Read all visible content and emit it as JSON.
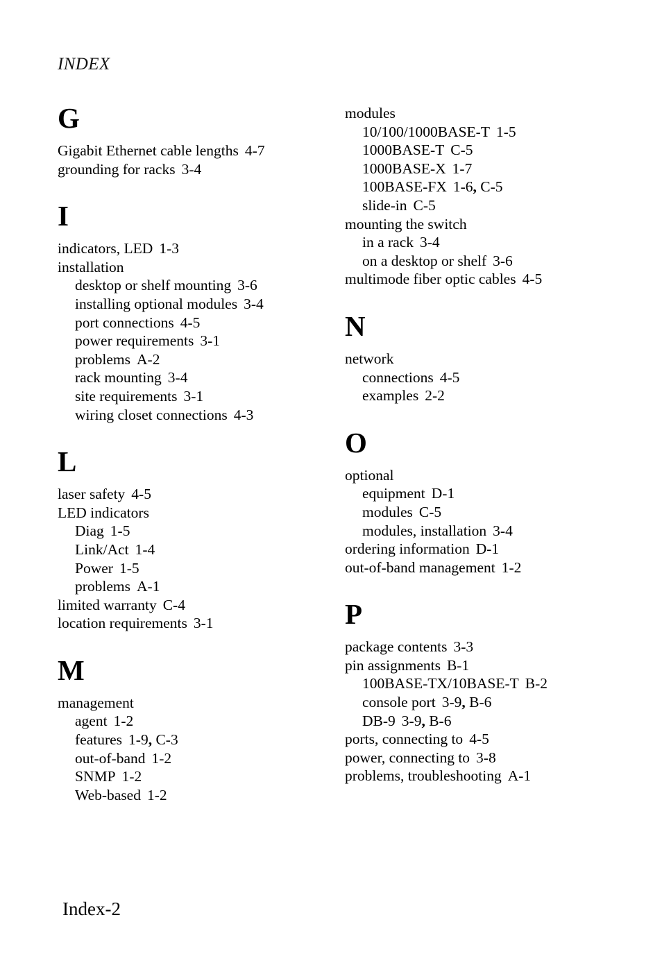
{
  "running_head": "INDEX",
  "folio": "Index-2",
  "columns": [
    {
      "id": "left",
      "sections": [
        {
          "letter": "G",
          "entries": [
            {
              "level": 0,
              "term": "Gigabit Ethernet cable lengths",
              "refs": [
                "4-7"
              ]
            },
            {
              "level": 0,
              "term": "grounding for racks",
              "refs": [
                "3-4"
              ]
            }
          ]
        },
        {
          "letter": "I",
          "entries": [
            {
              "level": 0,
              "term": "indicators, LED",
              "refs": [
                "1-3"
              ]
            },
            {
              "level": 0,
              "term": "installation",
              "refs": []
            },
            {
              "level": 1,
              "term": "desktop or shelf mounting",
              "refs": [
                "3-6"
              ]
            },
            {
              "level": 1,
              "term": "installing optional modules",
              "refs": [
                "3-4"
              ]
            },
            {
              "level": 1,
              "term": "port connections",
              "refs": [
                "4-5"
              ]
            },
            {
              "level": 1,
              "term": "power requirements",
              "refs": [
                "3-1"
              ]
            },
            {
              "level": 1,
              "term": "problems",
              "refs": [
                "A-2"
              ]
            },
            {
              "level": 1,
              "term": "rack mounting",
              "refs": [
                "3-4"
              ]
            },
            {
              "level": 1,
              "term": "site requirements",
              "refs": [
                "3-1"
              ]
            },
            {
              "level": 1,
              "term": "wiring closet connections",
              "refs": [
                "4-3"
              ]
            }
          ]
        },
        {
          "letter": "L",
          "entries": [
            {
              "level": 0,
              "term": "laser safety",
              "refs": [
                "4-5"
              ]
            },
            {
              "level": 0,
              "term": "LED indicators",
              "refs": []
            },
            {
              "level": 1,
              "term": "Diag",
              "refs": [
                "1-5"
              ]
            },
            {
              "level": 1,
              "term": "Link/Act",
              "refs": [
                "1-4"
              ]
            },
            {
              "level": 1,
              "term": "Power",
              "refs": [
                "1-5"
              ]
            },
            {
              "level": 1,
              "term": "problems",
              "refs": [
                "A-1"
              ]
            },
            {
              "level": 0,
              "term": "limited warranty",
              "refs": [
                "C-4"
              ]
            },
            {
              "level": 0,
              "term": "location requirements",
              "refs": [
                "3-1"
              ]
            }
          ]
        },
        {
          "letter": "M",
          "entries": [
            {
              "level": 0,
              "term": "management",
              "refs": []
            },
            {
              "level": 1,
              "term": "agent",
              "refs": [
                "1-2"
              ]
            },
            {
              "level": 1,
              "term": "features",
              "refs": [
                "1-9",
                "C-3"
              ]
            },
            {
              "level": 1,
              "term": "out-of-band",
              "refs": [
                "1-2"
              ]
            },
            {
              "level": 1,
              "term": "SNMP",
              "refs": [
                "1-2"
              ]
            },
            {
              "level": 1,
              "term": "Web-based",
              "refs": [
                "1-2"
              ]
            }
          ]
        }
      ]
    },
    {
      "id": "right",
      "sections": [
        {
          "letter": "",
          "entries": [
            {
              "level": 0,
              "term": "modules",
              "refs": []
            },
            {
              "level": 1,
              "term": "10/100/1000BASE-T",
              "refs": [
                "1-5"
              ]
            },
            {
              "level": 1,
              "term": "1000BASE-T",
              "refs": [
                "C-5"
              ]
            },
            {
              "level": 1,
              "term": "1000BASE-X",
              "refs": [
                "1-7"
              ]
            },
            {
              "level": 1,
              "term": "100BASE-FX",
              "refs": [
                "1-6",
                "C-5"
              ]
            },
            {
              "level": 1,
              "term": "slide-in",
              "refs": [
                "C-5"
              ]
            },
            {
              "level": 0,
              "term": "mounting the switch",
              "refs": []
            },
            {
              "level": 1,
              "term": "in a rack",
              "refs": [
                "3-4"
              ]
            },
            {
              "level": 1,
              "term": "on a desktop or shelf",
              "refs": [
                "3-6"
              ]
            },
            {
              "level": 0,
              "term": "multimode fiber optic cables",
              "refs": [
                "4-5"
              ]
            }
          ]
        },
        {
          "letter": "N",
          "entries": [
            {
              "level": 0,
              "term": "network",
              "refs": []
            },
            {
              "level": 1,
              "term": "connections",
              "refs": [
                "4-5"
              ]
            },
            {
              "level": 1,
              "term": "examples",
              "refs": [
                "2-2"
              ]
            }
          ]
        },
        {
          "letter": "O",
          "entries": [
            {
              "level": 0,
              "term": "optional",
              "refs": []
            },
            {
              "level": 1,
              "term": "equipment",
              "refs": [
                "D-1"
              ]
            },
            {
              "level": 1,
              "term": "modules",
              "refs": [
                "C-5"
              ]
            },
            {
              "level": 1,
              "term": "modules, installation",
              "refs": [
                "3-4"
              ]
            },
            {
              "level": 0,
              "term": "ordering information",
              "refs": [
                "D-1"
              ]
            },
            {
              "level": 0,
              "term": "out-of-band management",
              "refs": [
                "1-2"
              ]
            }
          ]
        },
        {
          "letter": "P",
          "entries": [
            {
              "level": 0,
              "term": "package contents",
              "refs": [
                "3-3"
              ]
            },
            {
              "level": 0,
              "term": "pin assignments",
              "refs": [
                "B-1"
              ]
            },
            {
              "level": 1,
              "term": "100BASE-TX/10BASE-T",
              "refs": [
                "B-2"
              ]
            },
            {
              "level": 1,
              "term": "console port",
              "refs": [
                "3-9",
                "B-6"
              ]
            },
            {
              "level": 1,
              "term": "DB-9",
              "refs": [
                "3-9",
                "B-6"
              ]
            },
            {
              "level": 0,
              "term": "ports, connecting to",
              "refs": [
                "4-5"
              ]
            },
            {
              "level": 0,
              "term": "power, connecting to",
              "refs": [
                "3-8"
              ]
            },
            {
              "level": 0,
              "term": "problems, troubleshooting",
              "refs": [
                "A-1"
              ]
            }
          ]
        }
      ]
    }
  ]
}
